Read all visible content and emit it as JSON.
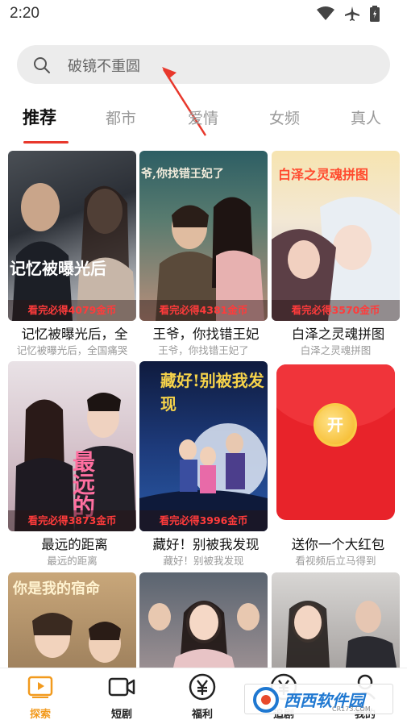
{
  "status_bar": {
    "time": "2:20"
  },
  "search": {
    "text": "破镜不重圆"
  },
  "tabs": [
    "推荐",
    "都市",
    "爱情",
    "女频",
    "真人"
  ],
  "cards": [
    {
      "badge": "看完必得4079金币",
      "title": "记忆被曝光后，全",
      "subtitle": "记忆被曝光后，全国痛哭",
      "cover_text": "记忆被曝光后"
    },
    {
      "badge": "看完必得4381金币",
      "title": "王爷，你找错王妃",
      "subtitle": "王爷，你找错王妃了",
      "cover_text": "爷,你找错王妃了"
    },
    {
      "badge": "看完必得3570金币",
      "title": "白泽之灵魂拼图",
      "subtitle": "白泽之灵魂拼图",
      "cover_text": "白泽之灵魂拼图"
    },
    {
      "badge": "看完必得3873金币",
      "title": "最远的距离",
      "subtitle": "最远的距离",
      "cover_text": "最远的"
    },
    {
      "badge": "看完必得3996金币",
      "title": "藏好！别被我发现",
      "subtitle": "藏好！别被我发现",
      "cover_text": "藏好!别被我发现"
    },
    {
      "badge": "",
      "title": "送你一个大红包",
      "subtitle": "看视频后立马得到",
      "cover_text": "开"
    },
    {
      "badge": "",
      "title": "",
      "subtitle": "",
      "cover_text": "你是我的宿命"
    },
    {
      "badge": "",
      "title": "",
      "subtitle": "",
      "cover_text": ""
    },
    {
      "badge": "",
      "title": "",
      "subtitle": "",
      "cover_text": ""
    }
  ],
  "bottom_nav": [
    {
      "label": "探索",
      "icon": "play-square-icon",
      "active": true
    },
    {
      "label": "短剧",
      "icon": "video-camera-icon",
      "active": false
    },
    {
      "label": "福利",
      "icon": "yuan-coin-icon",
      "active": false
    },
    {
      "label": "追剧",
      "icon": "yuan-coin-icon",
      "active": false
    },
    {
      "label": "我的",
      "icon": "user-icon",
      "active": false
    }
  ],
  "watermark": {
    "text": "西西软件园",
    "small": "CR173.COM"
  },
  "colors": {
    "accent_red": "#e8382c",
    "nav_active": "#f29a1d",
    "badge_red": "#ff3b3b"
  }
}
